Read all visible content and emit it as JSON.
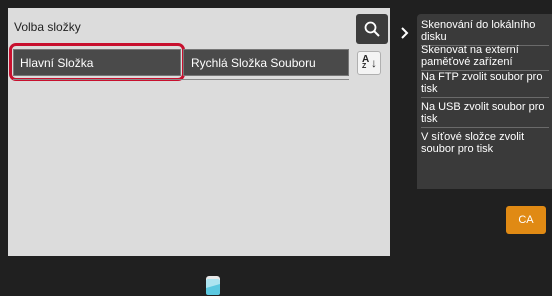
{
  "panel": {
    "title": "Volba složky"
  },
  "tabs": [
    {
      "label": "Hlavní Složka",
      "selected": true
    },
    {
      "label": "Rychlá Složka Souboru",
      "selected": false
    }
  ],
  "icons": {
    "search": "search-icon",
    "sort": "sort-az-icon",
    "expand": "chevron-right-icon",
    "toner": "toner-level-icon"
  },
  "actions": [
    "Skenování do lokálního disku",
    "Skenovat na externí paměťové zařízení",
    "Na FTP zvolit soubor pro tisk",
    "Na USB zvolit soubor pro tisk",
    "V síťové složce zvolit soubor pro tisk"
  ],
  "ca_button": {
    "label": "CA"
  },
  "colors": {
    "selection_ring": "#c8102e",
    "ca_button": "#e08a14",
    "toner": "#5bc8e0"
  }
}
